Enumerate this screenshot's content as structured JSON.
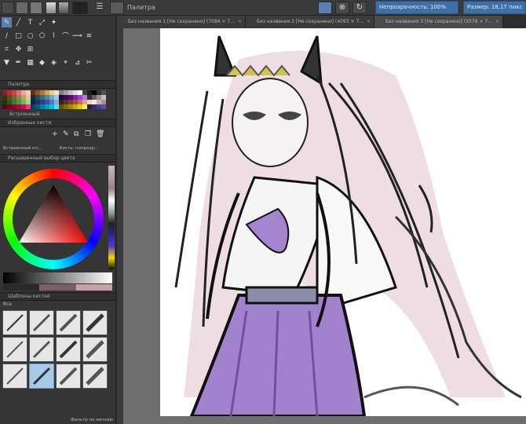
{
  "topbar": {
    "preset_label": "Палитра",
    "blue_btn_1": "Непрозрачность: 100%",
    "blue_btn_2": "Размер: 18,17 пикс"
  },
  "tabs": [
    {
      "label": "Без названия 1 [Не сохранено] (7084 × 7…"
    },
    {
      "label": "Без названия 2 [Не сохранено] (4093 × 7…"
    },
    {
      "label": "Без названия 3 [Не сохранено] (5578 × 7…"
    }
  ],
  "panels": {
    "palette_title": "Палитра",
    "palette_footer": "Встроенный",
    "favorites_title": "Избранные кисти",
    "layer_preset_left": "Встроенный кл...",
    "layer_preset_right": "Кисть: попрозр...",
    "color_title": "Расширенный выбор цвета",
    "brush_title": "Шаблоны кистей",
    "brush_tag": "Все",
    "brush_footer": "Фильтр по меткам"
  },
  "colors": {
    "accent": "#3d6fa8",
    "panel": "#353535",
    "canvas_bg": "#6e6e6e",
    "paper": "#ffffff",
    "hair_pink": "#e3c9d3",
    "skirt_purple": "#9b7cc4",
    "tiara_gold": "#c9c24e"
  },
  "icons": {
    "brush_tool": "brush-icon",
    "text_tool": "text-icon",
    "wrap_tool": "wrap-icon",
    "fill_tool": "fill-icon",
    "eyedrop": "eyedropper-icon"
  }
}
